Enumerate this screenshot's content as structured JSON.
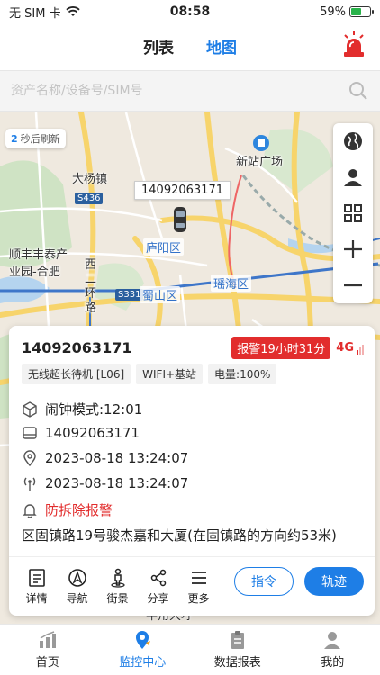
{
  "status_bar": {
    "carrier": "无 SIM 卡",
    "time": "08:58",
    "battery": "59%",
    "battery_level": 0.59
  },
  "header": {
    "tabs": [
      {
        "label": "列表"
      },
      {
        "label": "地图"
      }
    ]
  },
  "search": {
    "placeholder": "资产名称/设备号/SIM号"
  },
  "map": {
    "refresh_seconds": "2",
    "refresh_text": "秒后刷新",
    "device_tag": "14092063171",
    "labels": {
      "xinzhan": "新站广场",
      "dayang": "大杨镇",
      "shunfeng_1": "顺丰丰泰产",
      "shunfeng_2": "业园-合肥",
      "xierhuan_1": "西",
      "xierhuan_2": "二",
      "xierhuan_3": "环",
      "xierhuan_4": "路",
      "luyang": "庐阳区",
      "shushan": "蜀山区",
      "yaohai": "瑶海区",
      "niujiao": "牛角大圩"
    },
    "road_badges": {
      "s436": "S436",
      "s331": "S331"
    }
  },
  "card": {
    "device_id": "14092063171",
    "alarm_badge": "报警19小时31分",
    "network": "4G",
    "signal_level": 1,
    "chips": [
      "无线超长待机 [L06]",
      "WIFI+基站",
      "电量:100%"
    ],
    "rows": {
      "mode": "闹钟模式:12:01",
      "sim": "14092063171",
      "location_time": "2023-08-18 13:24:07",
      "signal_time": "2023-08-18 13:24:07",
      "alarm": "防拆除报警"
    },
    "address": "区固镇路19号骏杰嘉和大厦(在固镇路的方向约53米)",
    "actions": [
      "详情",
      "导航",
      "街景",
      "分享",
      "更多"
    ],
    "cmd_button": "指令",
    "track_button": "轨迹"
  },
  "bottom_nav": [
    {
      "label": "首页"
    },
    {
      "label": "监控中心"
    },
    {
      "label": "数据报表"
    },
    {
      "label": "我的"
    }
  ],
  "colors": {
    "accent": "#1e7ee6",
    "alarm": "#e22d2d"
  }
}
